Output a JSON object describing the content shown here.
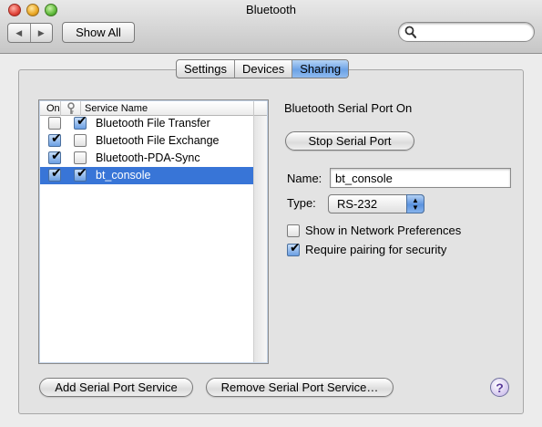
{
  "window": {
    "title": "Bluetooth"
  },
  "toolbar": {
    "back_icon": "◀",
    "forward_icon": "▶",
    "show_all_label": "Show All",
    "search_value": "",
    "search_placeholder": ""
  },
  "tabs": [
    {
      "label": "Settings",
      "active": false
    },
    {
      "label": "Devices",
      "active": false
    },
    {
      "label": "Sharing",
      "active": true
    }
  ],
  "services_table": {
    "headers": {
      "on": "On",
      "key": "key-icon",
      "name": "Service Name"
    },
    "rows": [
      {
        "on": false,
        "secure": true,
        "name": "Bluetooth File Transfer",
        "selected": false
      },
      {
        "on": true,
        "secure": false,
        "name": "Bluetooth File Exchange",
        "selected": false
      },
      {
        "on": true,
        "secure": false,
        "name": "Bluetooth-PDA-Sync",
        "selected": false
      },
      {
        "on": true,
        "secure": true,
        "name": "bt_console",
        "selected": true
      }
    ]
  },
  "details": {
    "status": "Bluetooth Serial Port On",
    "stop_button": "Stop Serial Port",
    "name_label": "Name:",
    "name_value": "bt_console",
    "type_label": "Type:",
    "type_value": "RS-232",
    "show_in_network_label": "Show in Network Preferences",
    "show_in_network_checked": false,
    "require_pairing_label": "Require pairing for security",
    "require_pairing_checked": true
  },
  "footer": {
    "add_button": "Add Serial Port Service",
    "remove_button": "Remove Serial Port Service…",
    "help_label": "?"
  },
  "colors": {
    "selection": "#3875d7",
    "tab_active": "#6ca2e6"
  }
}
